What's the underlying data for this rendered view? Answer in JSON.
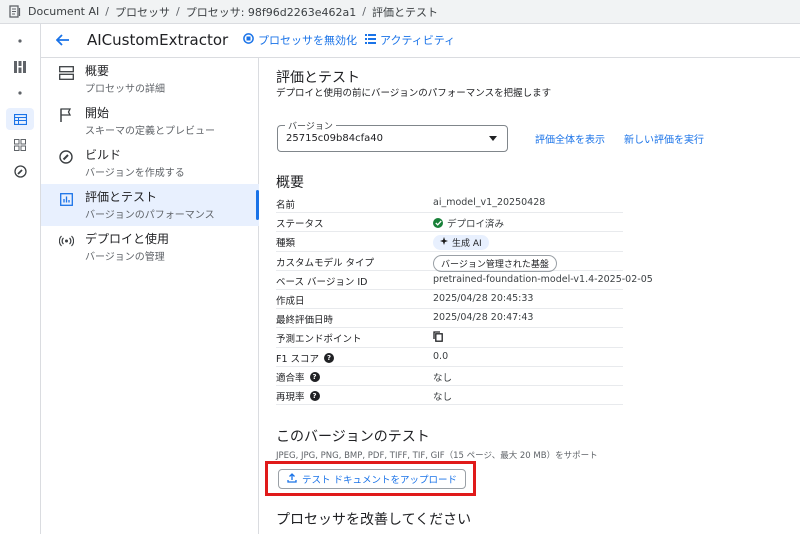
{
  "breadcrumb": {
    "items": [
      "Document AI",
      "プロセッサ",
      "プロセッサ: 98f96d2263e462a1",
      "評価とテスト"
    ],
    "separator": "/"
  },
  "header": {
    "title": "AICustomExtractor",
    "disable_label": "プロセッサを無効化",
    "activity_label": "アクティビティ"
  },
  "nav": {
    "items": [
      {
        "title": "概要",
        "sub": "プロセッサの詳細",
        "icon": "overview-icon"
      },
      {
        "title": "開始",
        "sub": "スキーマの定義とプレビュー",
        "icon": "flag-icon"
      },
      {
        "title": "ビルド",
        "sub": "バージョンを作成する",
        "icon": "build-icon"
      },
      {
        "title": "評価とテスト",
        "sub": "バージョンのパフォーマンス",
        "icon": "chart-icon",
        "active": true
      },
      {
        "title": "デプロイと使用",
        "sub": "バージョンの管理",
        "icon": "broadcast-icon"
      }
    ]
  },
  "main": {
    "title": "評価とテスト",
    "subtitle": "デプロイと使用の前にバージョンのパフォーマンスを把握します",
    "version_label": "バージョン",
    "version_value": "25715c09b84cfa40",
    "view_all_label": "評価全体を表示",
    "new_eval_label": "新しい評価を実行",
    "overview_title": "概要",
    "rows": [
      {
        "key": "名前",
        "value": "ai_model_v1_20250428"
      },
      {
        "key": "ステータス",
        "value": "デプロイ済み"
      },
      {
        "key": "種類",
        "value": "生成 AI"
      },
      {
        "key": "カスタムモデル タイプ",
        "value": "バージョン管理された基盤"
      },
      {
        "key": "ベース バージョン ID",
        "value": "pretrained-foundation-model-v1.4-2025-02-05"
      },
      {
        "key": "作成日",
        "value": "2025/04/28 20:45:33"
      },
      {
        "key": "最終評価日時",
        "value": "2025/04/28 20:47:43"
      },
      {
        "key": "予測エンドポイント",
        "value": ""
      },
      {
        "key": "F1 スコア",
        "value": "0.0"
      },
      {
        "key": "適合率",
        "value": "なし"
      },
      {
        "key": "再現率",
        "value": "なし"
      }
    ],
    "test_title": "このバージョンのテスト",
    "formats": "JPEG, JPG, PNG, BMP, PDF, TIFF, TIF, GIF（15 ページ、最大 20 MB）をサポート",
    "upload_label": "テスト ドキュメントをアップロード",
    "improve_title": "プロセッサを改善してください"
  },
  "colors": {
    "accent": "#1a73e8",
    "highlight": "#e01a1a",
    "success": "#188038"
  }
}
